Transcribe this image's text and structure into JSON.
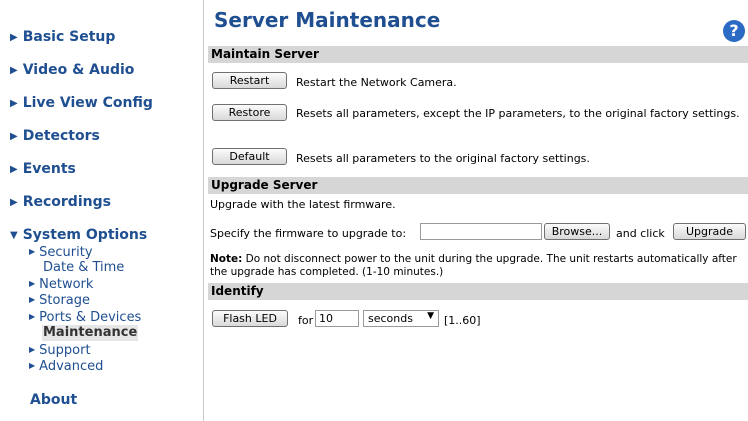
{
  "sidebar": {
    "items": [
      {
        "label": "Basic Setup"
      },
      {
        "label": "Video & Audio"
      },
      {
        "label": "Live View Config"
      },
      {
        "label": "Detectors"
      },
      {
        "label": "Events"
      },
      {
        "label": "Recordings"
      },
      {
        "label": "System Options"
      },
      {
        "label": "About"
      }
    ],
    "system_options_subitems": [
      {
        "label": "Security",
        "expandable": true
      },
      {
        "label": "Date & Time",
        "expandable": false
      },
      {
        "label": "Network",
        "expandable": true
      },
      {
        "label": "Storage",
        "expandable": true
      },
      {
        "label": "Ports & Devices",
        "expandable": true
      },
      {
        "label": "Maintenance",
        "expandable": false,
        "active": true
      },
      {
        "label": "Support",
        "expandable": true
      },
      {
        "label": "Advanced",
        "expandable": true
      }
    ]
  },
  "page": {
    "title": "Server Maintenance",
    "help_icon": "?"
  },
  "maintain": {
    "header": "Maintain Server",
    "restart_label": "Restart",
    "restart_desc": "Restart the Network Camera.",
    "restore_label": "Restore",
    "restore_desc": "Resets all parameters, except the IP parameters, to the original factory settings.",
    "default_label": "Default",
    "default_desc": "Resets all parameters to the original factory settings."
  },
  "upgrade": {
    "header": "Upgrade Server",
    "intro": "Upgrade with the latest firmware.",
    "specify_text": "Specify the firmware to upgrade to:",
    "file_value": "",
    "browse_label": "Browse...",
    "and_click": "and click",
    "upgrade_label": "Upgrade",
    "note_bold": "Note:",
    "note_text": " Do not disconnect power to the unit during the upgrade. The unit restarts automatically after the upgrade has completed. (1-10 minutes.)"
  },
  "identify": {
    "header": "Identify",
    "flash_label": "Flash LED",
    "for_text": "for",
    "duration_value": "10",
    "unit_selected": "seconds",
    "range_text": "[1..60]"
  },
  "colors": {
    "link": "#1f4f91",
    "section_bar": "#d6d6d6",
    "help": "#2c6bc4"
  }
}
